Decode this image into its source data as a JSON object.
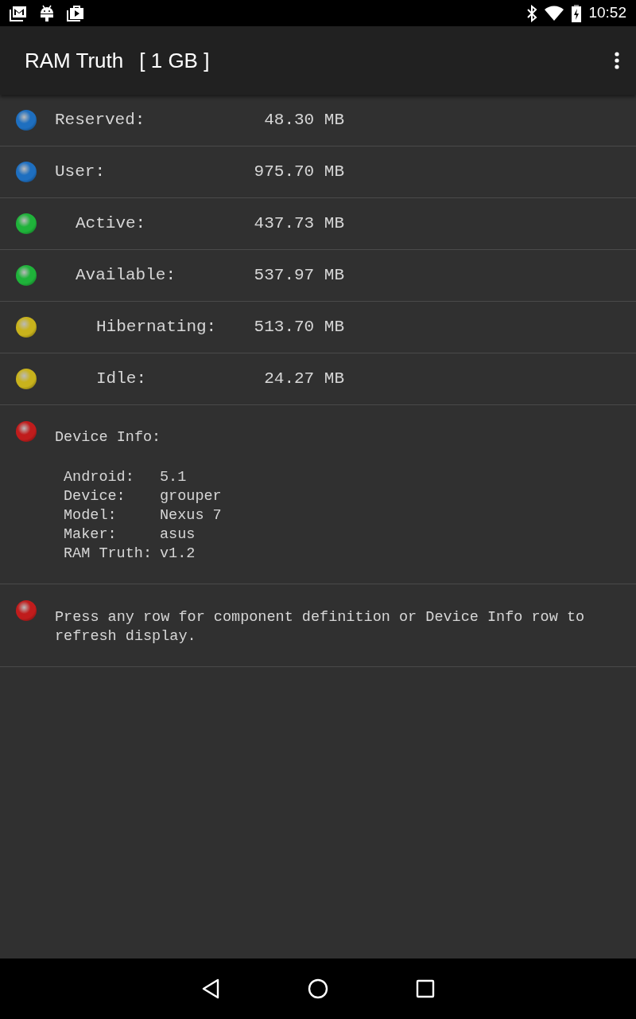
{
  "status_bar": {
    "time": "10:52"
  },
  "app_bar": {
    "title": "RAM Truth",
    "memory": "[ 1 GB ]"
  },
  "memory_rows": [
    {
      "label": "Reserved:",
      "value": "48.30 MB",
      "color": "#1e6fc0"
    },
    {
      "label": "User:",
      "value": "975.70 MB",
      "color": "#1e6fc0",
      "children": [
        {
          "label": "Active:",
          "value": "437.73 MB",
          "color": "#1fb33a"
        },
        {
          "label": "Available:",
          "value": "537.97 MB",
          "color": "#1fb33a",
          "children": [
            {
              "label": "Hibernating:",
              "value": "513.70 MB",
              "color": "#c8b21c"
            },
            {
              "label": "Idle:",
              "value": "24.27 MB",
              "color": "#c8b21c"
            }
          ]
        }
      ]
    }
  ],
  "device_info": {
    "title": "Device Info:",
    "color": "#c01c1c",
    "items": [
      {
        "label": "Android:",
        "value": "5.1"
      },
      {
        "label": "Device:",
        "value": "grouper"
      },
      {
        "label": "Model:",
        "value": "Nexus 7"
      },
      {
        "label": "Maker:",
        "value": "asus"
      },
      {
        "label": "RAM Truth:",
        "value": "v1.2"
      }
    ]
  },
  "hint": {
    "text": "Press any row for component definition or Device Info row to refresh display.",
    "color": "#c01c1c"
  }
}
